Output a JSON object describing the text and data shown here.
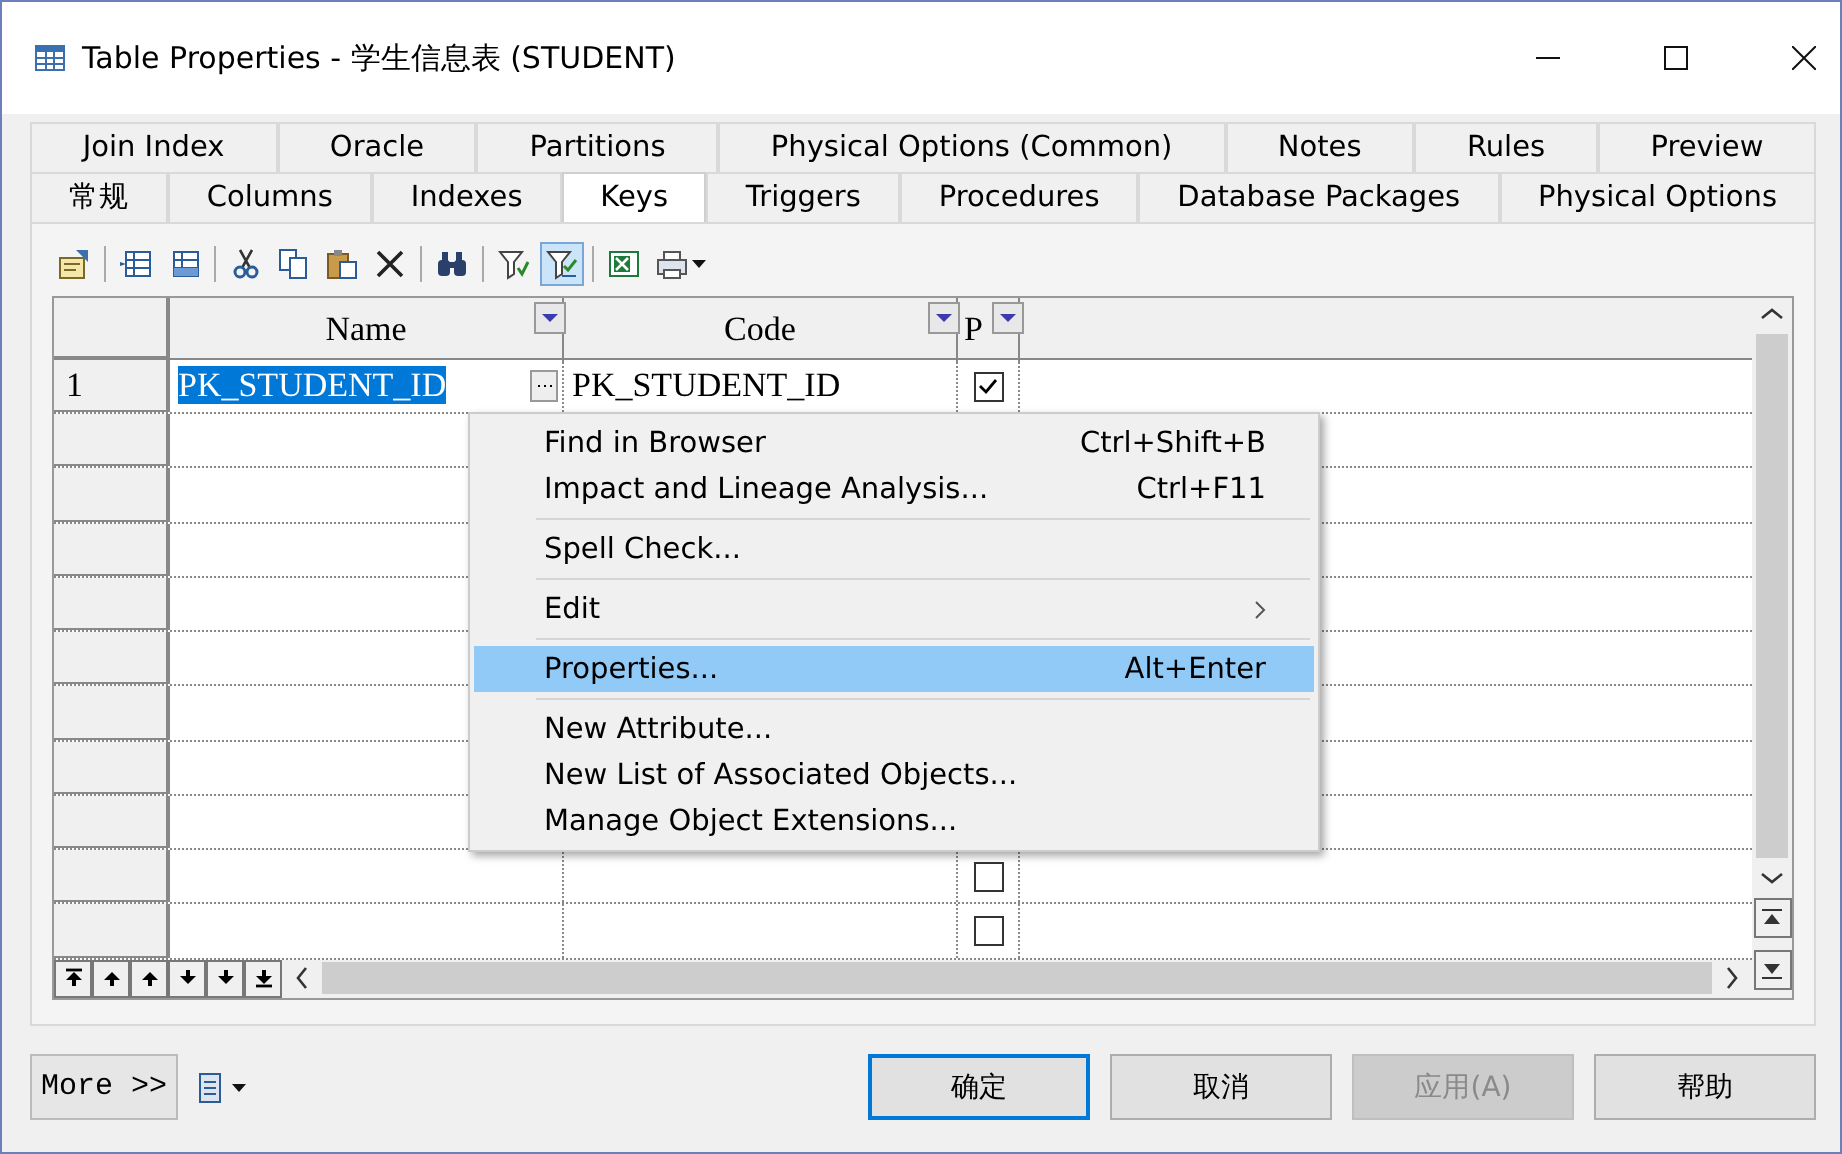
{
  "window": {
    "title": "Table Properties - 学生信息表 (STUDENT)"
  },
  "tab_rows": [
    [
      {
        "label": "Join Index",
        "selected": false
      },
      {
        "label": "Oracle",
        "selected": false
      },
      {
        "label": "Partitions",
        "selected": false
      },
      {
        "label": "Physical Options (Common)",
        "selected": false
      },
      {
        "label": "Notes",
        "selected": false
      },
      {
        "label": "Rules",
        "selected": false
      },
      {
        "label": "Preview",
        "selected": false
      }
    ],
    [
      {
        "label": "常规",
        "selected": false
      },
      {
        "label": "Columns",
        "selected": false
      },
      {
        "label": "Indexes",
        "selected": false
      },
      {
        "label": "Keys",
        "selected": true
      },
      {
        "label": "Triggers",
        "selected": false
      },
      {
        "label": "Procedures",
        "selected": false
      },
      {
        "label": "Database Packages",
        "selected": false
      },
      {
        "label": "Physical Options",
        "selected": false
      }
    ]
  ],
  "toolbar": [
    {
      "kind": "properties",
      "pressed": false
    },
    {
      "kind": "sep"
    },
    {
      "kind": "insert-row",
      "pressed": false
    },
    {
      "kind": "add-row",
      "pressed": false
    },
    {
      "kind": "sep"
    },
    {
      "kind": "cut",
      "pressed": false
    },
    {
      "kind": "copy",
      "pressed": false
    },
    {
      "kind": "paste",
      "pressed": false
    },
    {
      "kind": "delete",
      "pressed": false
    },
    {
      "kind": "sep"
    },
    {
      "kind": "find",
      "pressed": false
    },
    {
      "kind": "sep"
    },
    {
      "kind": "filter",
      "pressed": false
    },
    {
      "kind": "checklist",
      "pressed": true
    },
    {
      "kind": "sep"
    },
    {
      "kind": "export",
      "pressed": false
    },
    {
      "kind": "print",
      "pressed": false
    }
  ],
  "table": {
    "columns": [
      "Name",
      "Code",
      "P"
    ],
    "rows": [
      {
        "kind": "data",
        "number": "1",
        "name": "PK_STUDENT_ID",
        "code": "PK_STUDENT_ID",
        "primary": true,
        "selected": true
      },
      {
        "kind": "blank"
      },
      {
        "kind": "blank"
      },
      {
        "kind": "blank"
      },
      {
        "kind": "blank"
      },
      {
        "kind": "blank"
      },
      {
        "kind": "blank"
      },
      {
        "kind": "blank"
      },
      {
        "kind": "blank"
      },
      {
        "kind": "blank",
        "primary": false
      },
      {
        "kind": "blank",
        "primary": false
      }
    ]
  },
  "context_menu": [
    {
      "kind": "item",
      "label": "Find in Browser",
      "shortcut": "Ctrl+Shift+B",
      "selected": false
    },
    {
      "kind": "item",
      "label": "Impact and Lineage Analysis...",
      "shortcut": "Ctrl+F11",
      "selected": false
    },
    {
      "kind": "sep"
    },
    {
      "kind": "item",
      "label": "Spell Check...",
      "selected": false
    },
    {
      "kind": "sep"
    },
    {
      "kind": "submenu",
      "label": "Edit",
      "selected": false
    },
    {
      "kind": "sep"
    },
    {
      "kind": "item",
      "label": "Properties...",
      "shortcut": "Alt+Enter",
      "selected": true
    },
    {
      "kind": "sep"
    },
    {
      "kind": "item",
      "label": "New Attribute...",
      "selected": false
    },
    {
      "kind": "item",
      "label": "New List of Associated Objects...",
      "selected": false
    },
    {
      "kind": "item",
      "label": "Manage Object Extensions...",
      "selected": false
    }
  ],
  "footer": {
    "more": "More >>",
    "buttons": [
      {
        "label": "确定",
        "default": true,
        "disabled": false
      },
      {
        "label": "取消",
        "default": false,
        "disabled": false
      },
      {
        "label": "应用(A)",
        "default": false,
        "disabled": true
      },
      {
        "label": "帮助",
        "default": false,
        "disabled": false
      }
    ]
  }
}
